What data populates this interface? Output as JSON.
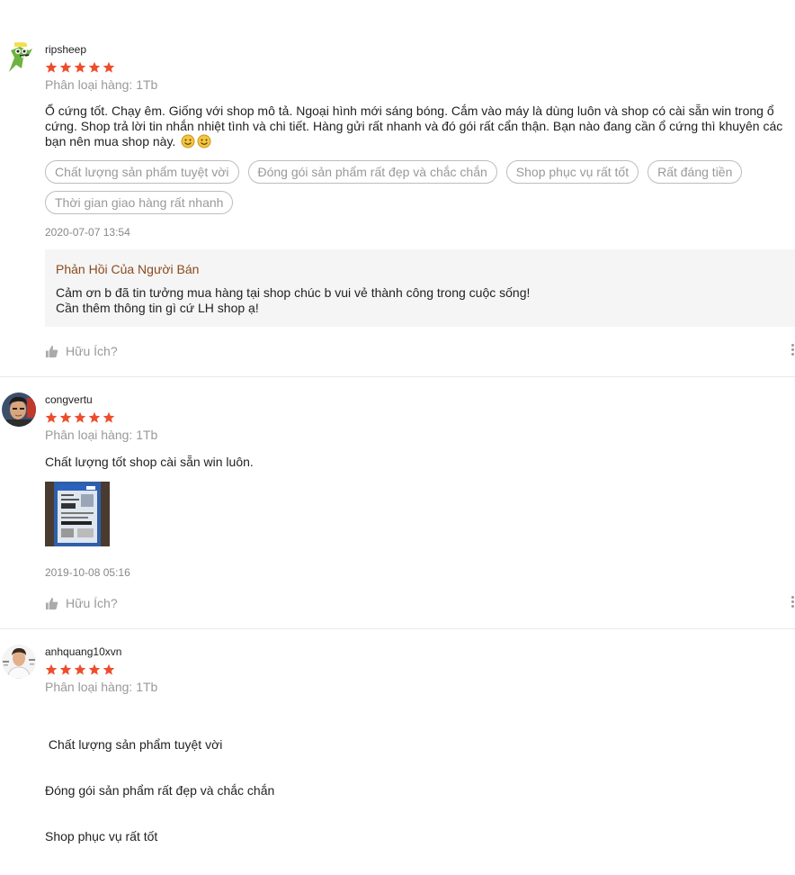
{
  "reviews": [
    {
      "username": "ripsheep",
      "rating": 5,
      "variation": "Phân loại hàng: 1Tb",
      "content": "Ổ cứng tốt. Chạy êm. Giống với shop mô tả. Ngoại hình mới sáng bóng. Cắm vào máy là dùng luôn và shop có cài sẵn win trong ổ cứng. Shop trả lời tin nhắn nhiệt tình và chi tiết. Hàng gửi rất nhanh và đó gói rất cẩn thận. Bạn nào đang cần ổ cứng thì khuyên các bạn nên mua shop này.",
      "tags": [
        "Chất lượng sản phẩm tuyệt vời",
        "Đóng gói sản phẩm rất đẹp và chắc chắn",
        "Shop phục vụ rất tốt",
        "Rất đáng tiền",
        "Thời gian giao hàng rất nhanh"
      ],
      "date": "2020-07-07 13:54",
      "seller_reply": {
        "title": "Phản Hồi Của Người Bán",
        "line1": "Cảm ơn b đã tin tưởng mua hàng tại shop chúc b vui vẻ thành công trong cuộc sống!",
        "line2": "Cần thêm thông tin gì cứ LH shop ạ!"
      },
      "helpful_label": "Hữu Ích?"
    },
    {
      "username": "congvertu",
      "rating": 5,
      "variation": "Phân loại hàng: 1Tb",
      "content": "Chất lượng tốt shop cài sẵn win luôn.",
      "date": "2019-10-08 05:16",
      "helpful_label": "Hữu Ích?"
    },
    {
      "username": "anhquang10xvn",
      "rating": 5,
      "variation": "Phân loại hàng: 1Tb",
      "content_lines": [
        " Chất lượng sản phẩm tuyệt vời",
        "Đóng gói sản phẩm rất đẹp và chắc chắn",
        "Shop phục vụ rất tốt"
      ]
    }
  ],
  "colors": {
    "star": "#ee4d2d",
    "seller_title": "#8b4a1e",
    "muted": "#999999"
  },
  "icons": [
    "thumbs-up-icon",
    "kebab-menu-icon",
    "star-icon",
    "smiley-emoji-icon"
  ]
}
